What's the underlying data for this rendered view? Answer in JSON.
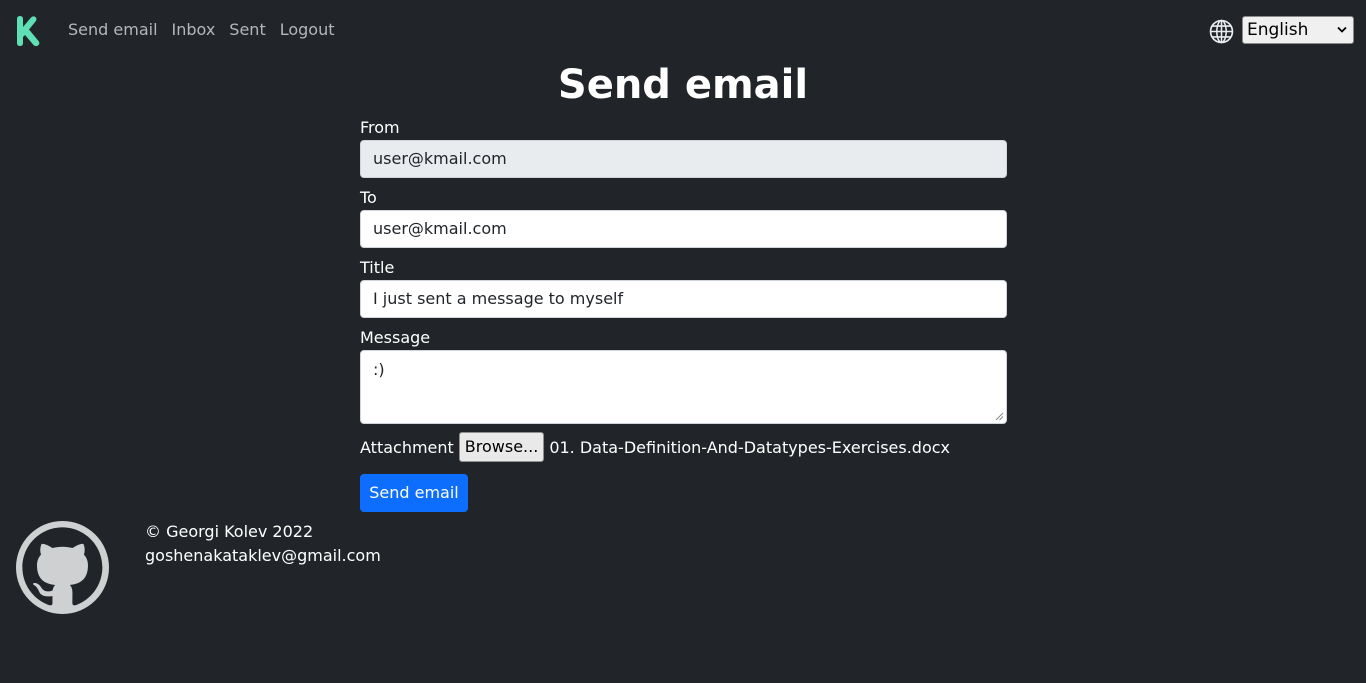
{
  "nav": {
    "logo_icon": "kmail-k-logo",
    "links": [
      "Send email",
      "Inbox",
      "Sent",
      "Logout"
    ],
    "language_icon": "globe-icon",
    "language_selected": "English"
  },
  "page": {
    "title": "Send email"
  },
  "form": {
    "from_label": "From",
    "from_value": "user@kmail.com",
    "to_label": "To",
    "to_value": "user@kmail.com",
    "title_label": "Title",
    "title_value": "I just sent a message to myself",
    "message_label": "Message",
    "message_value": ":)",
    "attachment_label": "Attachment",
    "browse_label": "Browse...",
    "attachment_file": "01. Data-Definition-And-Datatypes-Exercises.docx",
    "submit_label": "Send email"
  },
  "footer": {
    "github_icon": "github-icon",
    "copyright": "© Georgi Kolev 2022",
    "email": "goshenakataklev@gmail.com"
  },
  "colors": {
    "background": "#212529",
    "accent": "#0d6efd",
    "logo": "#5fe0b4"
  }
}
